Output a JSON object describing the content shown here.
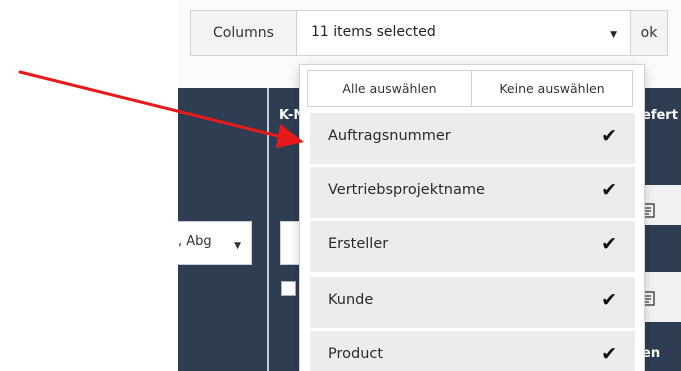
{
  "toolbar": {
    "columns_label": "Columns",
    "select_value": "11 items selected",
    "ok_label": "ok"
  },
  "dropdown": {
    "select_all": "Alle auswählen",
    "select_none": "Keine auswählen",
    "items": [
      {
        "label": "Auftragsnummer",
        "checked": true
      },
      {
        "label": "Vertriebsprojektname",
        "checked": true
      },
      {
        "label": "Ersteller",
        "checked": true
      },
      {
        "label": "Kunde",
        "checked": true
      },
      {
        "label": "Product",
        "checked": true
      }
    ]
  },
  "background": {
    "header_partial_left": "K-N",
    "header_partial_right": "efert",
    "row_partial_right": "en",
    "filter_select_value": ", Abg"
  },
  "colors": {
    "table_dark": "#2f3d52",
    "arrow": "#e8191b",
    "item_bg": "#ececec"
  },
  "icons": {
    "check": "checkmark-icon",
    "caret": "caret-down-icon",
    "doc": "document-icon"
  }
}
